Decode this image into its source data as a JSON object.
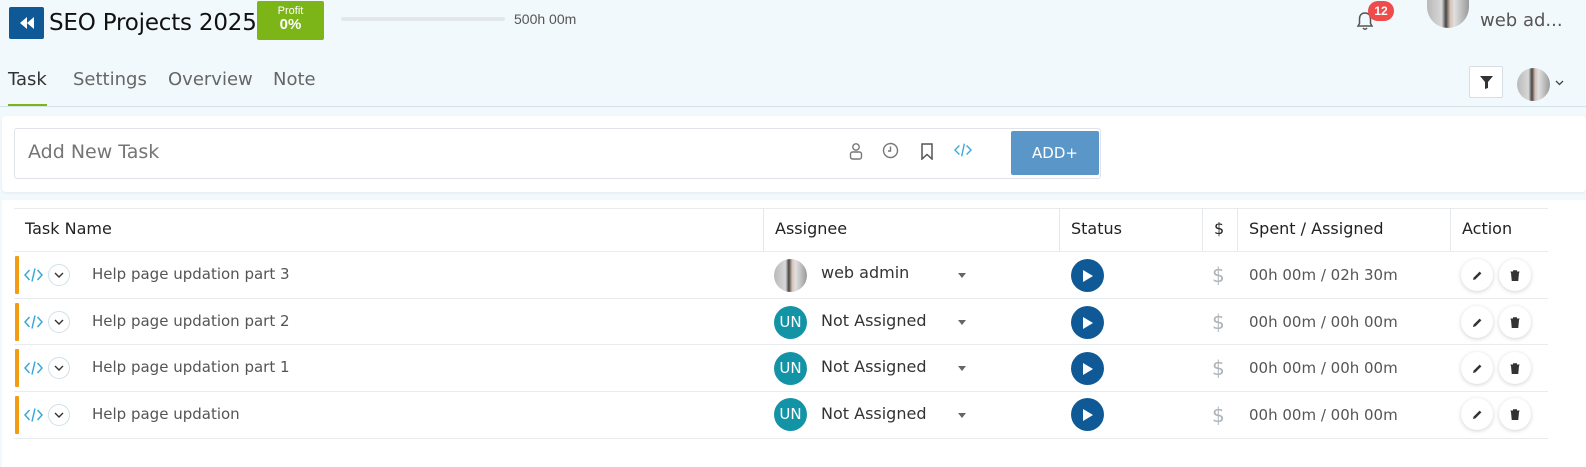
{
  "header": {
    "project_title": "SEO Projects 2025",
    "profit_label": "Profit",
    "profit_value": "0%",
    "progress_fraction": 0,
    "total_hours": "500h 00m",
    "notification_count": "12",
    "user_name": "web ad..."
  },
  "tabs": [
    {
      "label": "Task",
      "active": true
    },
    {
      "label": "Settings",
      "active": false
    },
    {
      "label": "Overview",
      "active": false
    },
    {
      "label": "Note",
      "active": false
    }
  ],
  "add_task": {
    "placeholder": "Add New Task",
    "add_button": "ADD+"
  },
  "table": {
    "columns": [
      "Task Name",
      "Assignee",
      "Status",
      "$",
      "Spent / Assigned",
      "Action"
    ],
    "rows": [
      {
        "task": "Help page updation part 3",
        "assignee": "web admin",
        "assignee_initials": "",
        "currency": "$",
        "spent_assigned": "00h 00m / 02h 30m"
      },
      {
        "task": "Help page updation part 2",
        "assignee": "Not Assigned",
        "assignee_initials": "UN",
        "currency": "$",
        "spent_assigned": "00h 00m / 00h 00m"
      },
      {
        "task": "Help page updation part 1",
        "assignee": "Not Assigned",
        "assignee_initials": "UN",
        "currency": "$",
        "spent_assigned": "00h 00m / 00h 00m"
      },
      {
        "task": "Help page updation",
        "assignee": "Not Assigned",
        "assignee_initials": "UN",
        "currency": "$",
        "spent_assigned": "00h 00m / 00h 00m"
      }
    ]
  },
  "colors": {
    "primary": "#0f5a96",
    "profit_green": "#7cb518",
    "badge_red": "#ef4b4b",
    "add_button": "#5b96c9",
    "row_priority": "#f39c12",
    "unassigned_avatar": "#1393a6"
  },
  "icons": {
    "back": "double-chevron-left-icon",
    "bell": "bell-icon",
    "filter": "filter-icon",
    "user": "user-icon",
    "clock": "clock-icon",
    "bookmark": "bookmark-icon",
    "code": "code-icon",
    "expand": "chevron-down-icon",
    "play": "play-icon",
    "edit": "pencil-icon",
    "delete": "trash-icon"
  }
}
